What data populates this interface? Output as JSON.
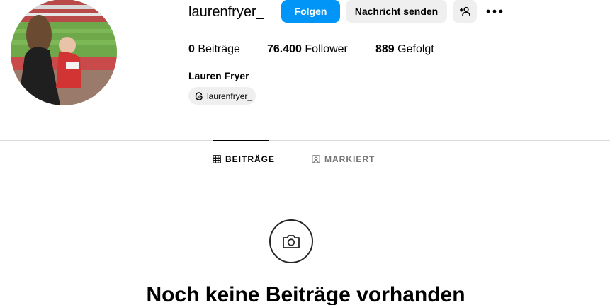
{
  "profile": {
    "username": "laurenfryer_",
    "full_name": "Lauren Fryer",
    "threads_handle": "laurenfryer_"
  },
  "actions": {
    "follow_label": "Folgen",
    "message_label": "Nachricht senden"
  },
  "stats": {
    "posts_count": "0",
    "posts_label": "Beiträge",
    "followers_count": "76.400",
    "followers_label": "Follower",
    "following_count": "889",
    "following_label": "Gefolgt"
  },
  "tabs": [
    {
      "label": "BEITRÄGE",
      "icon": "grid-icon",
      "active": true
    },
    {
      "label": "MARKIERT",
      "icon": "tagged-icon",
      "active": false
    }
  ],
  "empty_state": {
    "icon": "camera-icon",
    "title": "Noch keine Beiträge vorhanden"
  },
  "colors": {
    "accent": "#0095f6",
    "button_secondary": "#efefef",
    "divider": "#dbdbdb",
    "muted_text": "#737373"
  }
}
